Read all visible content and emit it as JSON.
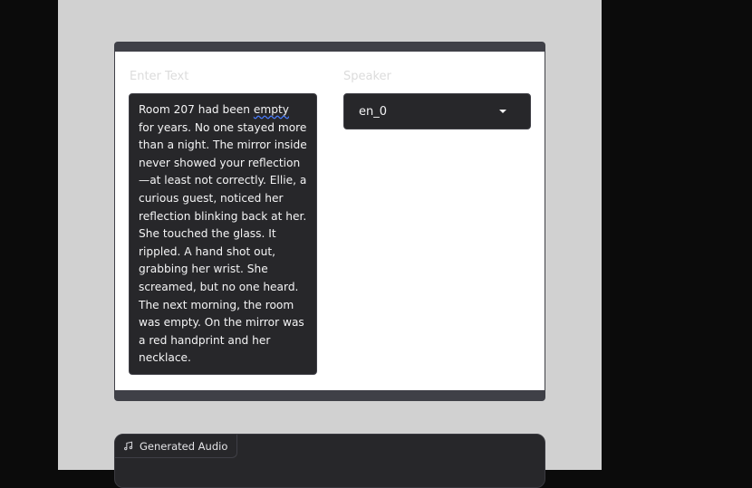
{
  "text_input": {
    "label": "Enter Text",
    "value_before": "Room 207 had been ",
    "value_flagged": "empty",
    "value_after": " for years. No one stayed more than a night. The mirror inside never showed your reflection—at least not correctly. Ellie, a curious guest, noticed her reflection blinking back at her. She touched the glass. It rippled. A hand shot out, grabbing her wrist. She screamed, but no one heard. The next morning, the room was empty. On the mirror was a red handprint and her necklace."
  },
  "speaker": {
    "label": "Speaker",
    "selected": "en_0"
  },
  "output": {
    "audio_label": "Generated Audio",
    "icon": "music-note-icon"
  }
}
